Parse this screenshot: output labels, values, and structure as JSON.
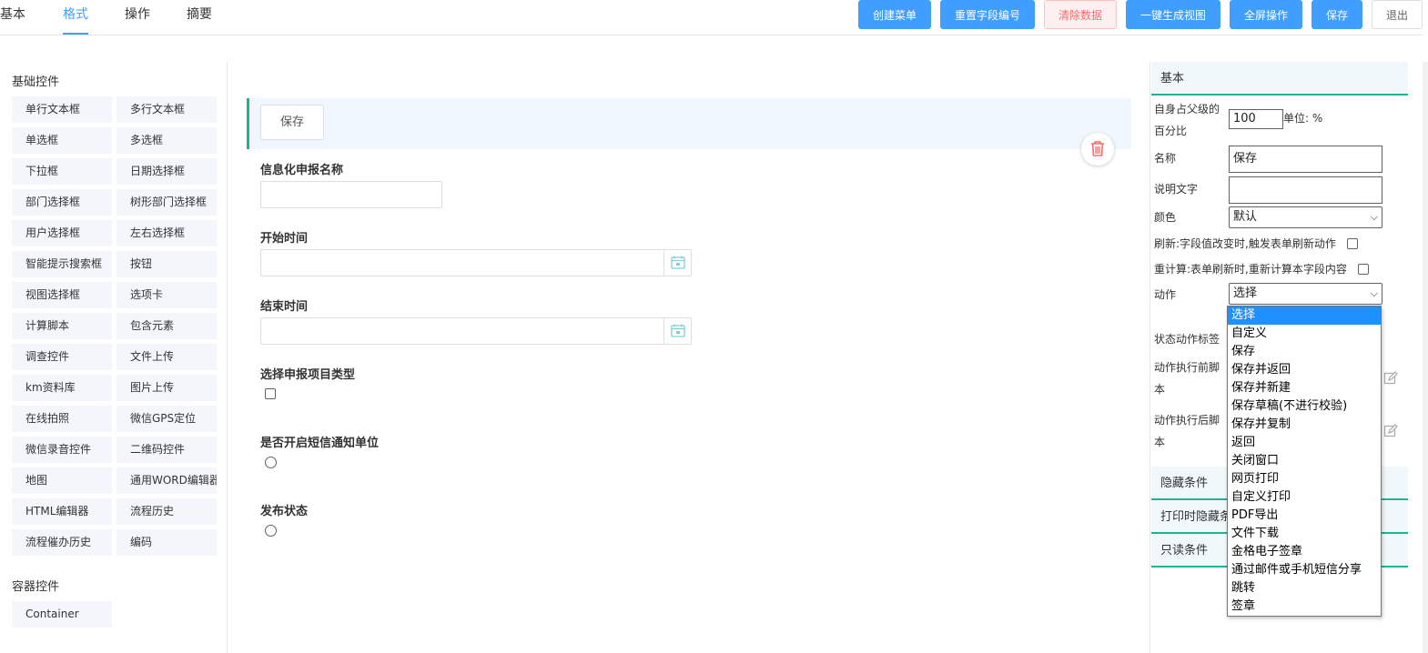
{
  "tabs": [
    {
      "label": "基本"
    },
    {
      "label": "格式"
    },
    {
      "label": "操作"
    },
    {
      "label": "摘要"
    }
  ],
  "toolbar": {
    "create_menu": "创建菜单",
    "reset_fields": "重置字段编号",
    "clear_data": "清除数据",
    "gen_view": "一键生成视图",
    "fullscreen": "全屏操作",
    "save": "保存",
    "exit": "退出"
  },
  "left": {
    "basic_title": "基础控件",
    "components": [
      "单行文本框",
      "多行文本框",
      "单选框",
      "多选框",
      "下拉框",
      "日期选择框",
      "部门选择框",
      "树形部门选择框",
      "用户选择框",
      "左右选择框",
      "智能提示搜索框",
      "按钮",
      "视图选择框",
      "选项卡",
      "计算脚本",
      "包含元素",
      "调查控件",
      "文件上传",
      "km资料库",
      "图片上传",
      "在线拍照",
      "微信GPS定位",
      "微信录音控件",
      "二维码控件",
      "地图",
      "通用WORD编辑器",
      "HTML编辑器",
      "流程历史",
      "流程催办历史",
      "编码"
    ],
    "container_title": "容器控件",
    "container_items": [
      "Container"
    ]
  },
  "canvas": {
    "save_button_label": "保存",
    "fields": [
      {
        "label": "信息化申报名称"
      },
      {
        "label": "开始时间"
      },
      {
        "label": "结束时间"
      },
      {
        "label": "选择申报项目类型"
      },
      {
        "label": "是否开启短信通知单位"
      },
      {
        "label": "发布状态"
      }
    ]
  },
  "right": {
    "basic_header": "基本",
    "percent_label": "自身占父级的百分比",
    "percent_value": "100",
    "unit_label": "单位: %",
    "name_label": "名称",
    "name_value": "保存",
    "desc_label": "说明文字",
    "desc_value": "",
    "color_label": "颜色",
    "color_value": "默认",
    "refresh_label": "刷新:字段值改变时,触发表单刷新动作",
    "recalc_label": "重计算:表单刷新时,重新计算本字段内容",
    "action_label": "动作",
    "action_value": "选择",
    "state_label": "状态动作标签",
    "pre_script_label": "动作执行前脚本",
    "post_script_label": "动作执行后脚本",
    "hide_header": "隐藏条件",
    "print_hide_header": "打印时隐藏条件",
    "readonly_header": "只读条件"
  },
  "action_options": [
    "选择",
    "自定义",
    "保存",
    "保存并返回",
    "保存并新建",
    "保存草稿(不进行校验)",
    "保存并复制",
    "返回",
    "关闭窗口",
    "网页打印",
    "自定义打印",
    "PDF导出",
    "文件下载",
    "金格电子签章",
    "通过邮件或手机短信分享",
    "跳转",
    "签章"
  ],
  "colors": {
    "accent": "#409eff",
    "teal": "#1ab394",
    "danger": "#f56c6c"
  }
}
